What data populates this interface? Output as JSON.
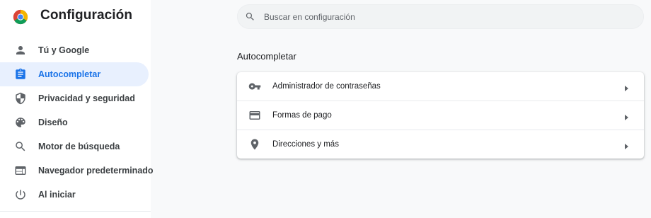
{
  "app": {
    "title": "Configuración",
    "logo_icon": "chrome-logo-icon"
  },
  "sidebar": {
    "items": [
      {
        "label": "Tú y Google",
        "icon": "person-icon",
        "active": false
      },
      {
        "label": "Autocompletar",
        "icon": "clipboard-icon",
        "active": true
      },
      {
        "label": "Privacidad y seguridad",
        "icon": "shield-icon",
        "active": false
      },
      {
        "label": "Diseño",
        "icon": "palette-icon",
        "active": false
      },
      {
        "label": "Motor de búsqueda",
        "icon": "search-icon",
        "active": false
      },
      {
        "label": "Navegador predeterminado",
        "icon": "browser-window-icon",
        "active": false
      },
      {
        "label": "Al iniciar",
        "icon": "power-icon",
        "active": false
      }
    ]
  },
  "search": {
    "placeholder": "Buscar en configuración",
    "value": ""
  },
  "main": {
    "section_title": "Autocompletar",
    "rows": [
      {
        "label": "Administrador de contraseñas",
        "icon": "key-icon"
      },
      {
        "label": "Formas de pago",
        "icon": "credit-card-icon"
      },
      {
        "label": "Direcciones y más",
        "icon": "location-pin-icon"
      }
    ]
  },
  "colors": {
    "accent": "#1a73e8",
    "active_bg": "#e8f0fe",
    "icon": "#5f6368",
    "page_bg": "#f8f9fa"
  }
}
